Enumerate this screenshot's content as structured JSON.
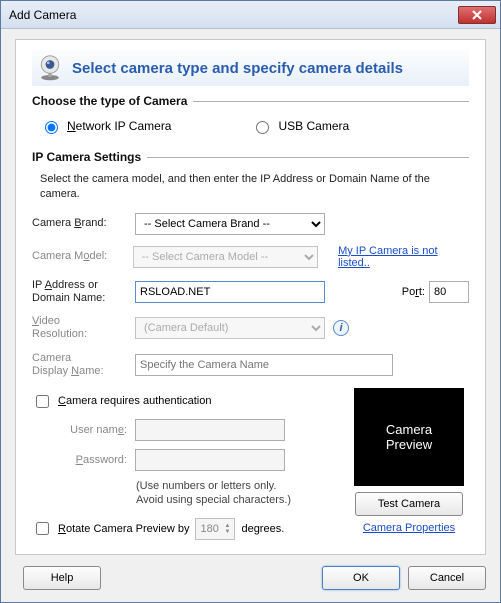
{
  "window": {
    "title": "Add Camera"
  },
  "heading": "Select camera type and specify camera details",
  "section_type": "Choose the type of Camera",
  "radios": {
    "network": "Network IP Camera",
    "usb": "USB Camera"
  },
  "section_ip": "IP Camera Settings",
  "ip_desc": "Select the camera model, and then enter the IP Address or Domain Name of the camera.",
  "labels": {
    "brand": "Camera Brand:",
    "model": "Camera Model:",
    "addr1": "IP Address or",
    "addr2": "Domain Name:",
    "port": "Port:",
    "video1": "Video",
    "video2": "Resolution:",
    "display1": "Camera",
    "display2": "Display Name:"
  },
  "values": {
    "brand": "-- Select Camera Brand --",
    "model": "-- Select Camera Model --",
    "addr": "RSLOAD.NET",
    "port": "80",
    "video": "(Camera Default)",
    "display_placeholder": "Specify the Camera Name"
  },
  "links": {
    "not_listed": "My IP Camera is not listed..",
    "cam_props": "Camera Properties"
  },
  "auth": {
    "checkbox": "Camera requires authentication",
    "user": "User name:",
    "pass": "Password:",
    "hint1": "(Use numbers or letters only.",
    "hint2": "Avoid using special characters.)"
  },
  "rotate": {
    "checkbox": "Rotate Camera Preview by",
    "degrees_value": "180",
    "suffix": "degrees."
  },
  "preview": {
    "line1": "Camera",
    "line2": "Preview",
    "test": "Test Camera"
  },
  "buttons": {
    "help": "Help",
    "ok": "OK",
    "cancel": "Cancel"
  }
}
